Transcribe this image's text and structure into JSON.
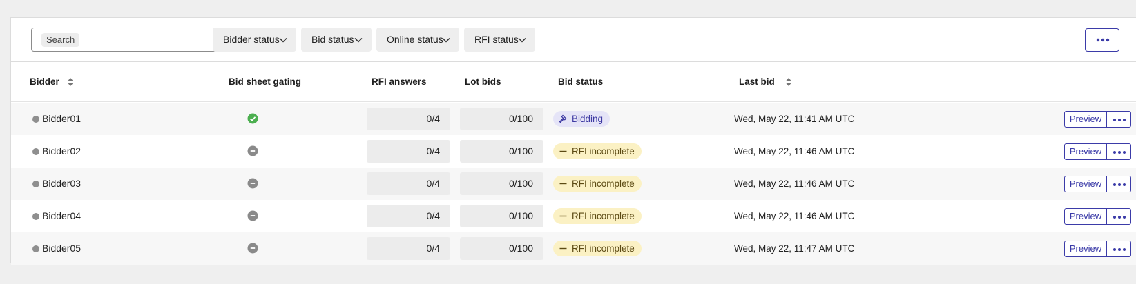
{
  "toolbar": {
    "search_placeholder": "Search",
    "filters": [
      {
        "label": "Bidder status"
      },
      {
        "label": "Bid status"
      },
      {
        "label": "Online status"
      },
      {
        "label": "RFI status"
      }
    ]
  },
  "table": {
    "headers": {
      "bidder": "Bidder",
      "bid_sheet_gating": "Bid sheet gating",
      "rfi_answers": "RFI answers",
      "lot_bids": "Lot bids",
      "bid_status": "Bid status",
      "last_bid": "Last bid"
    },
    "rows": [
      {
        "bidder": "Bidder01",
        "gating": "check-icon",
        "rfi_answers": "0/4",
        "lot_bids": "0/100",
        "bid_status": "Bidding",
        "status_kind": "bidding",
        "last_bid": "Wed, May 22, 11:41 AM UTC",
        "preview_label": "Preview"
      },
      {
        "bidder": "Bidder02",
        "gating": "minus-icon",
        "rfi_answers": "0/4",
        "lot_bids": "0/100",
        "bid_status": "RFI incomplete",
        "status_kind": "incomplete",
        "last_bid": "Wed, May 22, 11:46 AM UTC",
        "preview_label": "Preview"
      },
      {
        "bidder": "Bidder03",
        "gating": "minus-icon",
        "rfi_answers": "0/4",
        "lot_bids": "0/100",
        "bid_status": "RFI incomplete",
        "status_kind": "incomplete",
        "last_bid": "Wed, May 22, 11:46 AM UTC",
        "preview_label": "Preview"
      },
      {
        "bidder": "Bidder04",
        "gating": "minus-icon",
        "rfi_answers": "0/4",
        "lot_bids": "0/100",
        "bid_status": "RFI incomplete",
        "status_kind": "incomplete",
        "last_bid": "Wed, May 22, 11:46 AM UTC",
        "preview_label": "Preview"
      },
      {
        "bidder": "Bidder05",
        "gating": "minus-icon",
        "rfi_answers": "0/4",
        "lot_bids": "0/100",
        "bid_status": "RFI incomplete",
        "status_kind": "incomplete",
        "last_bid": "Wed, May 22, 11:47 AM UTC",
        "preview_label": "Preview"
      }
    ]
  },
  "colors": {
    "accent": "#3b3ba8",
    "check_green": "#4caf50",
    "gating_gray": "#8a8a8a",
    "bidding_bg": "#e5e4f7",
    "incomplete_bg": "#fbf1c4"
  }
}
